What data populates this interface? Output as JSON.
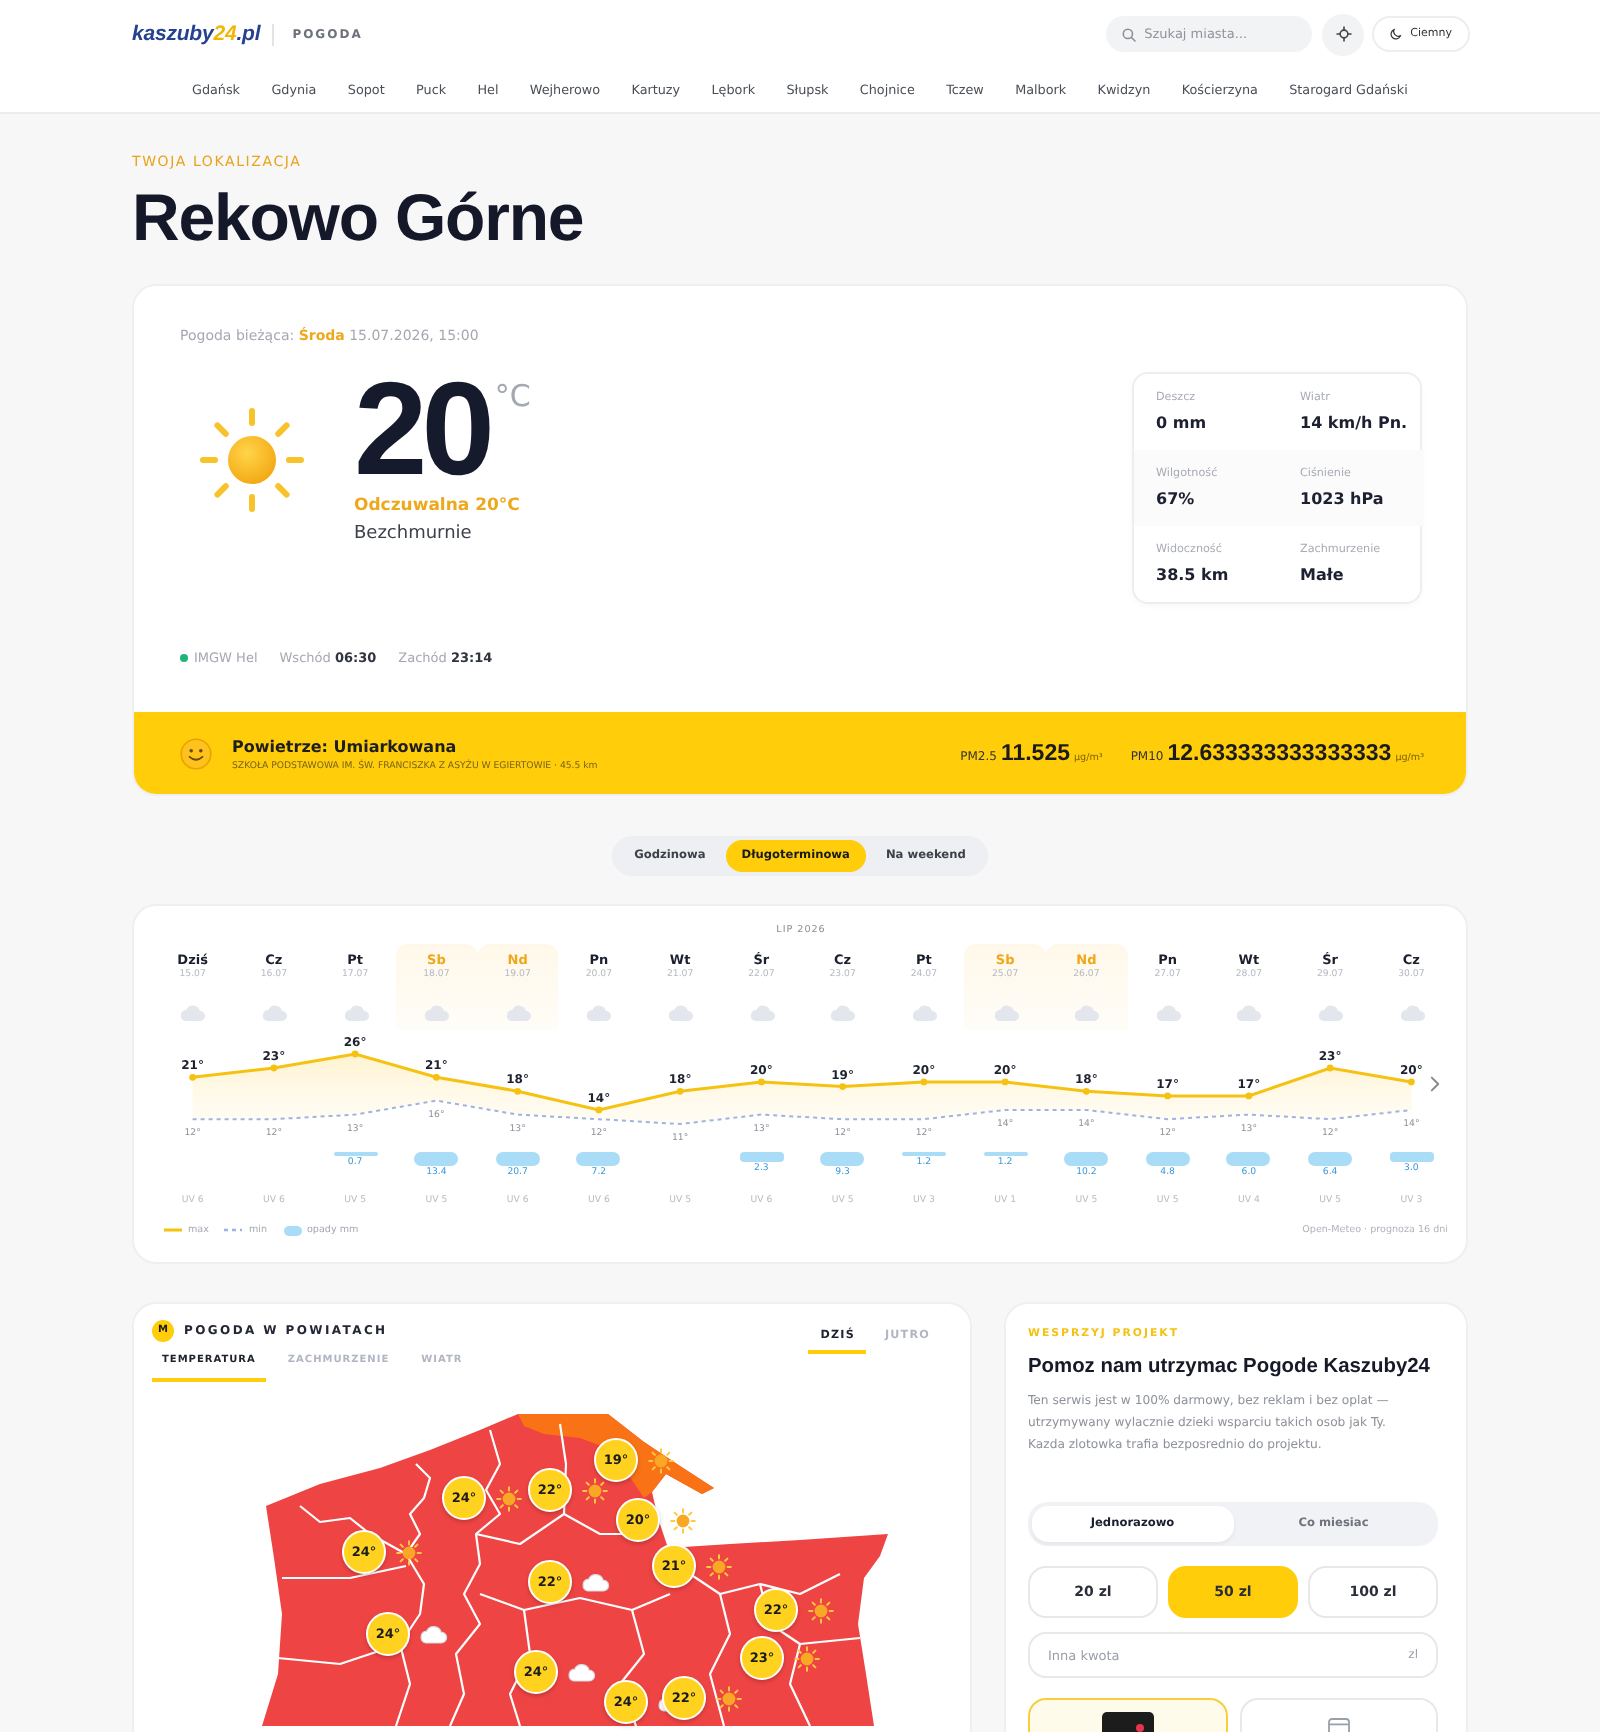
{
  "header": {
    "logo": [
      "kaszuby",
      "24",
      ".pl"
    ],
    "section": "POGODA",
    "search": {
      "placeholder": "Szukaj miasta..."
    },
    "theme_button": "Ciemny"
  },
  "city_nav": [
    "Gdańsk",
    "Gdynia",
    "Sopot",
    "Puck",
    "Hel",
    "Wejherowo",
    "Kartuzy",
    "Lębork",
    "Słupsk",
    "Chojnice",
    "Tczew",
    "Malbork",
    "Kwidzyn",
    "Kościerzyna",
    "Starogard Gdański"
  ],
  "location": {
    "eyebrow": "TWOJA LOKALIZACJA",
    "name": "Rekowo Górne"
  },
  "current": {
    "updated": "Pogoda bieżąca: **Środa** 15.07.2026, 15:00",
    "temperature": "20",
    "unit": "°C",
    "feels_like": "Odczuwalna 20°C",
    "condition": "Bezchmurnie",
    "stats": [
      {
        "label": "Deszcz",
        "value": "0 mm"
      },
      {
        "label": "Wiatr",
        "value": "14 km/h Pn."
      },
      {
        "label": "Wilgotność",
        "value": "67%"
      },
      {
        "label": "Ciśnienie",
        "value": "1023 hPa"
      },
      {
        "label": "Widoczność",
        "value": "38.5 km"
      },
      {
        "label": "Zachmurzenie",
        "value": "Małe"
      }
    ],
    "station": "IMGW Hel",
    "sunrise": "Wschód **06:30**",
    "sunset": "Zachód **23:14**"
  },
  "air": {
    "title": "Powietrze: Umiarkowana",
    "station": "SZKOŁA PODSTAWOWA IM. ŚW. FRANCISZKA Z ASYŻU W EGIERTOWIE · 45.5 km",
    "readings": [
      {
        "label": "PM2.5",
        "value": "11.525",
        "unit": "µg/m³"
      },
      {
        "label": "PM10",
        "value": "12.633333333333333",
        "unit": "µg/m³"
      }
    ]
  },
  "forecast_tabs": [
    {
      "label": "Godzinowa",
      "selected": false
    },
    {
      "label": "Długoterminowa",
      "selected": true
    },
    {
      "label": "Na weekend",
      "selected": false
    }
  ],
  "forecast": {
    "month": "LIP 2026",
    "days": [
      {
        "day": "Dziś",
        "date": "15.07",
        "weekend": false,
        "uv": "UV 6"
      },
      {
        "day": "Cz",
        "date": "16.07",
        "weekend": false,
        "uv": "UV 6"
      },
      {
        "day": "Pt",
        "date": "17.07",
        "weekend": false,
        "rain": {
          "amount": "0.7",
          "kind": "light"
        },
        "uv": "UV 5"
      },
      {
        "day": "Sb",
        "date": "18.07",
        "weekend": true,
        "rain": {
          "amount": "13.4",
          "kind": "heavy"
        },
        "uv": "UV 5"
      },
      {
        "day": "Nd",
        "date": "19.07",
        "weekend": true,
        "rain": {
          "amount": "20.7",
          "kind": "heavy"
        },
        "uv": "UV 6"
      },
      {
        "day": "Pn",
        "date": "20.07",
        "weekend": false,
        "rain": {
          "amount": "7.2",
          "kind": "heavy"
        },
        "uv": "UV 6"
      },
      {
        "day": "Wt",
        "date": "21.07",
        "weekend": false,
        "uv": "UV 5"
      },
      {
        "day": "Śr",
        "date": "22.07",
        "weekend": false,
        "rain": {
          "amount": "2.3",
          "kind": "medium"
        },
        "uv": "UV 6"
      },
      {
        "day": "Cz",
        "date": "23.07",
        "weekend": false,
        "rain": {
          "amount": "9.3",
          "kind": "heavy"
        },
        "uv": "UV 5"
      },
      {
        "day": "Pt",
        "date": "24.07",
        "weekend": false,
        "rain": {
          "amount": "1.2",
          "kind": "light"
        },
        "uv": "UV 3"
      },
      {
        "day": "Sb",
        "date": "25.07",
        "weekend": true,
        "rain": {
          "amount": "1.2",
          "kind": "light"
        },
        "uv": "UV 1"
      },
      {
        "day": "Nd",
        "date": "26.07",
        "weekend": true,
        "rain": {
          "amount": "10.2",
          "kind": "heavy"
        },
        "uv": "UV 5"
      },
      {
        "day": "Pn",
        "date": "27.07",
        "weekend": false,
        "rain": {
          "amount": "4.8",
          "kind": "heavy"
        },
        "uv": "UV 5"
      },
      {
        "day": "Wt",
        "date": "28.07",
        "weekend": false,
        "rain": {
          "amount": "6.0",
          "kind": "heavy"
        },
        "uv": "UV 4"
      },
      {
        "day": "Śr",
        "date": "29.07",
        "weekend": false,
        "rain": {
          "amount": "6.4",
          "kind": "heavy"
        },
        "uv": "UV 5"
      },
      {
        "day": "Cz",
        "date": "30.07",
        "weekend": false,
        "rain": {
          "amount": "3.0",
          "kind": "medium"
        },
        "uv": "UV 3"
      }
    ],
    "chart_data": {
      "type": "line",
      "series": [
        {
          "name": "max",
          "color": "#f5c211",
          "line_style": "solid",
          "marker": "circle",
          "values": [
            21,
            23,
            26,
            21,
            18,
            14,
            18,
            20,
            19,
            20,
            20,
            18,
            17,
            17,
            23,
            20
          ],
          "value_labels": [
            "21°",
            "23°",
            "26°",
            "21°",
            "18°",
            "14°",
            "18°",
            "20°",
            "19°",
            "20°",
            "20°",
            "18°",
            "17°",
            "17°",
            "23°",
            "20°"
          ]
        },
        {
          "name": "min",
          "color": "#9db4e0",
          "line_style": "dashed",
          "values": [
            12,
            12,
            13,
            16,
            13,
            12,
            11,
            13,
            12,
            12,
            14,
            14,
            12,
            13,
            12,
            14
          ],
          "value_labels": [
            "12°",
            "12°",
            "13°",
            "16°",
            "13°",
            "12°",
            "11°",
            "13°",
            "12°",
            "12°",
            "14°",
            "14°",
            "12°",
            "13°",
            "12°",
            "14°"
          ]
        }
      ]
    },
    "rain_legend": "opady mm",
    "source": "Open-Meteo · prognoza 16 dni"
  },
  "map": {
    "badge": "M",
    "title": "POGODA W POWIATACH",
    "day_tabs": [
      {
        "label": "DZIŚ",
        "selected": true
      },
      {
        "label": "JUTRO",
        "selected": false
      }
    ],
    "tabs": [
      {
        "label": "TEMPERATURA",
        "selected": true
      },
      {
        "label": "ZACHMURZENIE",
        "selected": false
      },
      {
        "label": "WIATR",
        "selected": false
      }
    ],
    "counties": [
      {
        "temp": "19°",
        "kind": "sunny"
      },
      {
        "temp": "22°",
        "kind": "sunny"
      },
      {
        "temp": "24°",
        "kind": "sunny"
      },
      {
        "temp": "20°",
        "kind": "sunny"
      },
      {
        "temp": "24°",
        "kind": "sunny"
      },
      {
        "temp": "21°",
        "kind": "sunny"
      },
      {
        "temp": "22°",
        "kind": "cloudy"
      },
      {
        "temp": "22°",
        "kind": "sunny"
      },
      {
        "temp": "24°",
        "kind": "cloudy"
      },
      {
        "temp": "23°",
        "kind": "sunny"
      },
      {
        "temp": "24°",
        "kind": "cloudy"
      },
      {
        "temp": "22°",
        "kind": "sunny"
      },
      {
        "temp": "24°",
        "kind": "cloudy"
      }
    ]
  },
  "support": {
    "eyebrow": "WESPRZYJ PROJEKT",
    "title": "Pomoz nam utrzymac Pogode Kaszuby24",
    "text": "Ten serwis jest w 100% darmowy, bez reklam i bez oplat — utrzymywany wylacznie dzieki wsparciu takich osob jak Ty. Kazda zlotowka trafia bezposrednio do projektu.",
    "frequency": [
      {
        "label": "Jednorazowo",
        "selected": true
      },
      {
        "label": "Co miesiac",
        "selected": false
      }
    ],
    "amounts": [
      {
        "label": "20 zl",
        "selected": false
      },
      {
        "label": "50 zl",
        "selected": true
      },
      {
        "label": "100 zl",
        "selected": false
      }
    ],
    "custom_amount": {
      "placeholder": "Inna kwota",
      "suffix": "zl"
    },
    "payment_methods": [
      {
        "kind": "blik",
        "selected": true
      },
      {
        "kind": "card",
        "selected": false
      }
    ]
  }
}
